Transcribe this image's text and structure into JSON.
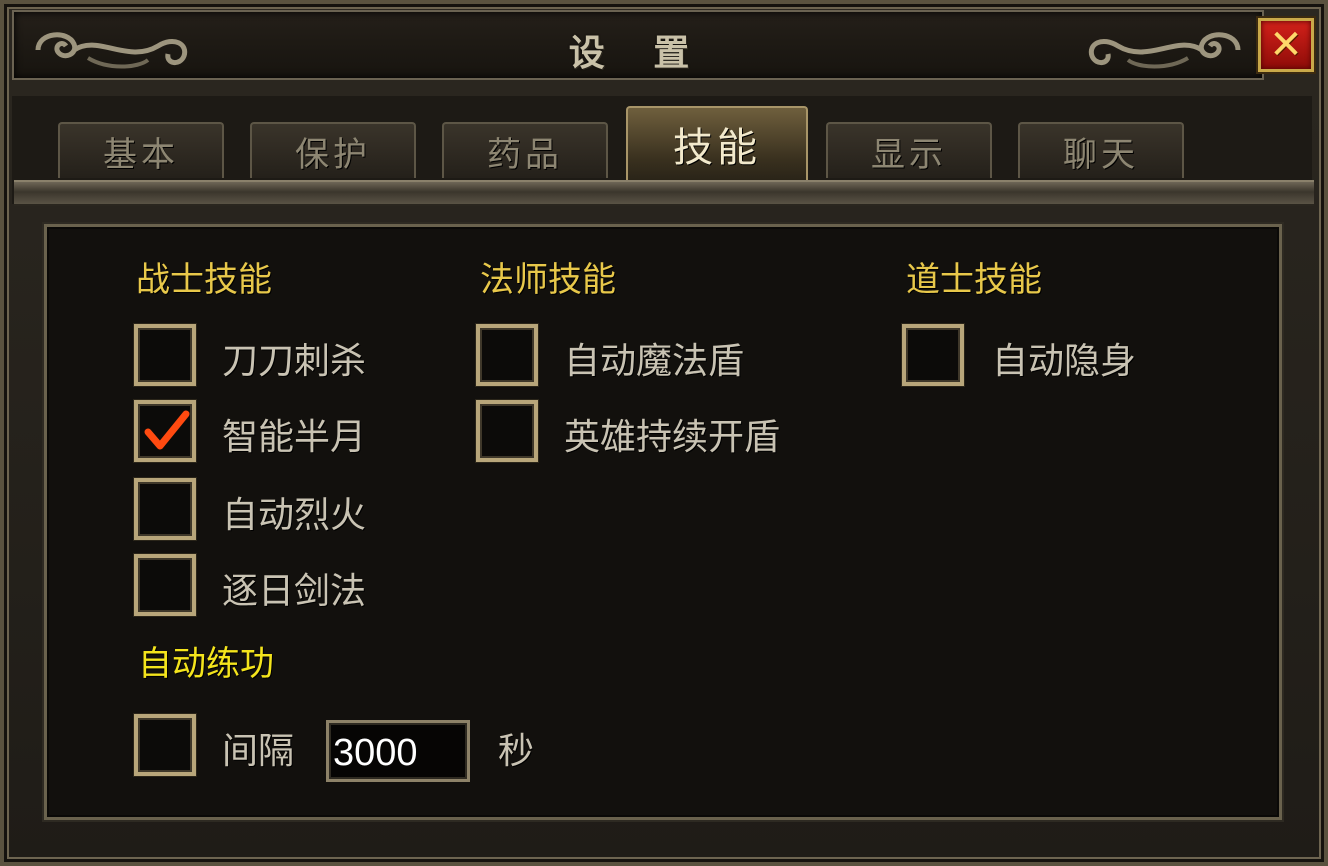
{
  "window": {
    "title": "设 置",
    "close_label": "✕"
  },
  "tabs": [
    {
      "label": "基本",
      "active": false
    },
    {
      "label": "保护",
      "active": false
    },
    {
      "label": "药品",
      "active": false
    },
    {
      "label": "技能",
      "active": true
    },
    {
      "label": "显示",
      "active": false
    },
    {
      "label": "聊天",
      "active": false
    }
  ],
  "warrior": {
    "heading": "战士技能",
    "options": [
      {
        "label": "刀刀刺杀",
        "checked": false
      },
      {
        "label": "智能半月",
        "checked": true
      },
      {
        "label": "自动烈火",
        "checked": false
      },
      {
        "label": "逐日剑法",
        "checked": false
      }
    ]
  },
  "mage": {
    "heading": "法师技能",
    "options": [
      {
        "label": "自动魔法盾",
        "checked": false
      },
      {
        "label": "英雄持续开盾",
        "checked": false
      }
    ]
  },
  "taoist": {
    "heading": "道士技能",
    "options": [
      {
        "label": "自动隐身",
        "checked": false
      }
    ]
  },
  "auto_practice": {
    "heading": "自动练功",
    "interval_label": "间隔",
    "interval_value": "3000",
    "unit_label": "秒",
    "checked": false
  },
  "colors": {
    "section_heading": "#e8c84a",
    "practice_heading": "#f4e41c",
    "checkmark": "#ff4a10",
    "close_button": "#c8160f"
  }
}
